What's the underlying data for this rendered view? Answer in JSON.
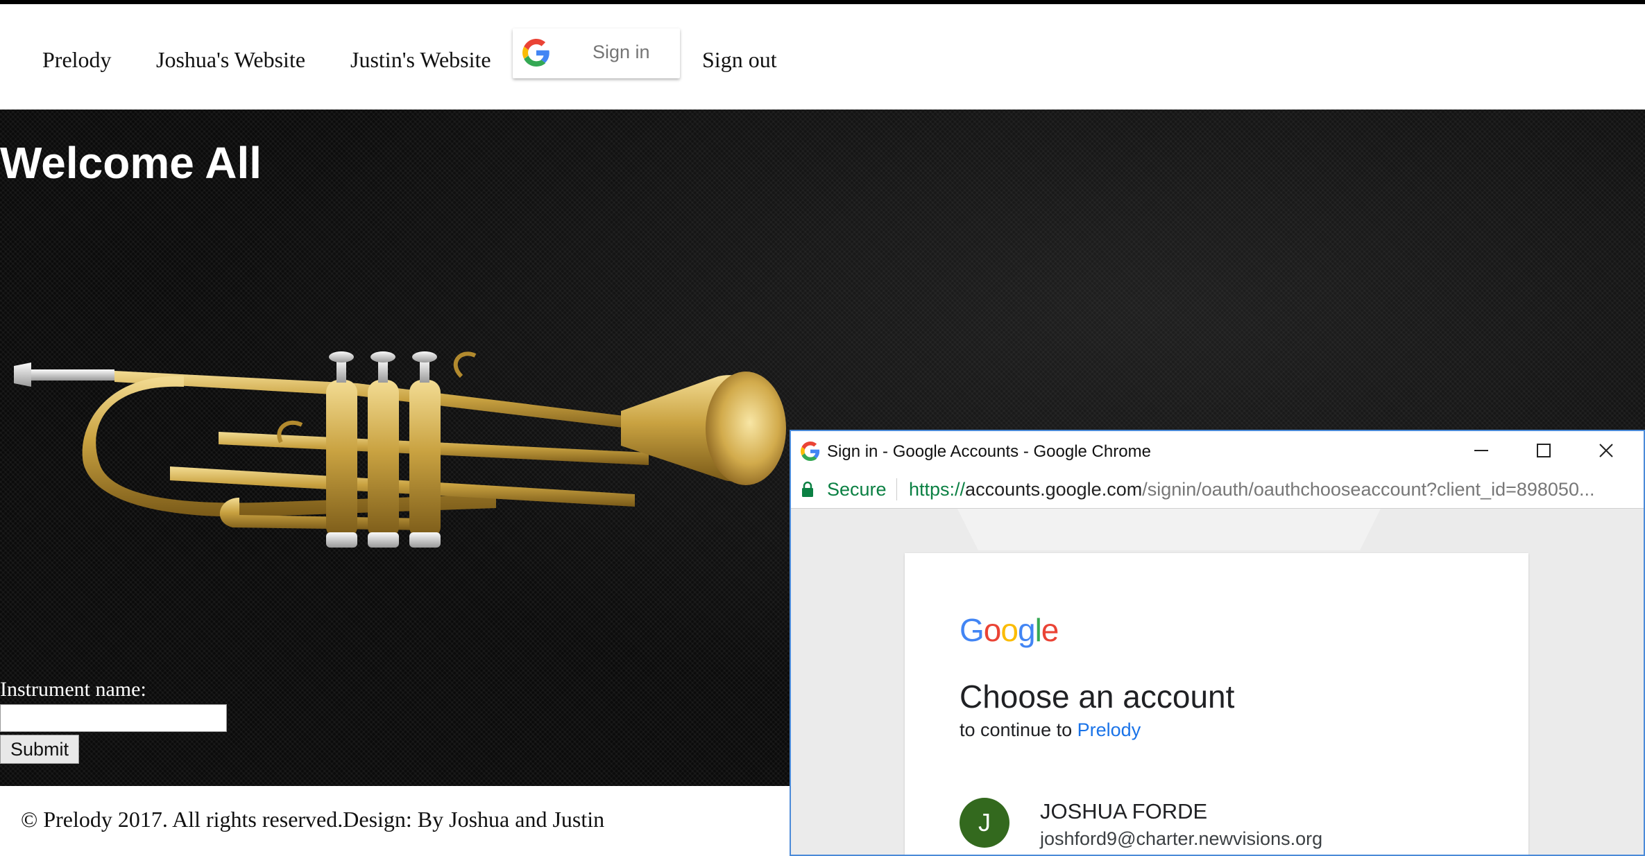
{
  "nav": {
    "links": [
      "Prelody",
      "Joshua's Website",
      "Justin's Website"
    ],
    "signin_label": "Sign in",
    "signout_label": "Sign out"
  },
  "hero": {
    "title": "Welcome All",
    "image_alt": "trumpet"
  },
  "form": {
    "label": "Instrument name:",
    "input_value": "",
    "submit_label": "Submit"
  },
  "footer": {
    "text": "© Prelody 2017. All rights reserved.Design: By Joshua and Justin"
  },
  "popup": {
    "window_title": "Sign in - Google Accounts - Google Chrome",
    "secure_label": "Secure",
    "url_scheme": "https://",
    "url_host": "accounts.google.com",
    "url_path": "/signin/oauth/oauthchooseaccount?client_id=898050...",
    "logo_letters": [
      "G",
      "o",
      "o",
      "g",
      "l",
      "e"
    ],
    "heading": "Choose an account",
    "continue_prefix": "to continue to",
    "app_name": "Prelody",
    "account": {
      "initial": "J",
      "name": "JOSHUA FORDE",
      "email": "joshford9@charter.newvisions.org",
      "avatar_color": "#33691e"
    }
  },
  "colors": {
    "google_blue": "#4285f4",
    "google_red": "#ea4335",
    "google_yellow": "#fbbc05",
    "google_green": "#34a853",
    "secure_green": "#0b8043",
    "link_blue": "#1a73e8",
    "window_border": "#4a8ad8"
  }
}
